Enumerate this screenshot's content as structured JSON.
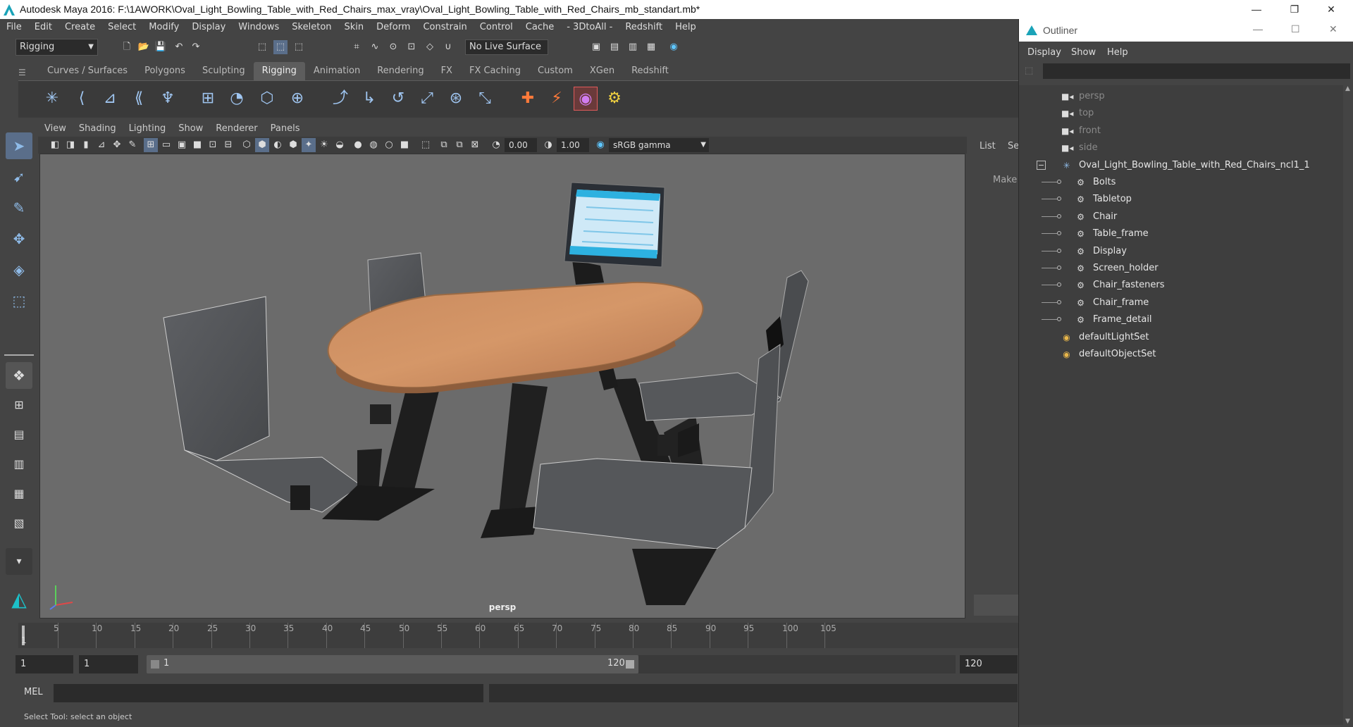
{
  "window": {
    "title": "Autodesk Maya 2016: F:\\1AWORK\\Oval_Light_Bowling_Table_with_Red_Chairs_max_vray\\Oval_Light_Bowling_Table_with_Red_Chairs_mb_standart.mb*",
    "controls": [
      "—",
      "❐",
      "✕"
    ]
  },
  "menubar": [
    "File",
    "Edit",
    "Create",
    "Select",
    "Modify",
    "Display",
    "Windows",
    "Skeleton",
    "Skin",
    "Deform",
    "Constrain",
    "Control",
    "Cache",
    "- 3DtoAll -",
    "Redshift",
    "Help"
  ],
  "statusline": {
    "mode": "Rigging",
    "live_surface": "No Live Surface"
  },
  "shelf_tabs": {
    "items": [
      "Curves / Surfaces",
      "Polygons",
      "Sculpting",
      "Rigging",
      "Animation",
      "Rendering",
      "FX",
      "FX Caching",
      "Custom",
      "XGen",
      "Redshift"
    ],
    "active": "Rigging"
  },
  "panel": {
    "menu": [
      "View",
      "Shading",
      "Lighting",
      "Show",
      "Renderer",
      "Panels"
    ],
    "exposure": "0.00",
    "gamma": "1.00",
    "color_space": "sRGB gamma",
    "camera": "persp"
  },
  "right_strip": {
    "list_label": "List",
    "se_label": "Se",
    "make_label": "Make"
  },
  "timeline": {
    "ticks": [
      "5",
      "10",
      "15",
      "20",
      "25",
      "30",
      "35",
      "40",
      "45",
      "50",
      "55",
      "60",
      "65",
      "70",
      "75",
      "80",
      "85",
      "90",
      "95",
      "100",
      "105"
    ],
    "current_frame": "1"
  },
  "range": {
    "start": "1",
    "playback_start": "1",
    "slider_start": "1",
    "slider_end": "120",
    "end": "120"
  },
  "mel": {
    "label": "MEL"
  },
  "help_line": "Select Tool: select an object",
  "outliner": {
    "title": "Outliner",
    "menu": [
      "Display",
      "Show",
      "Help"
    ],
    "items": [
      {
        "label": "persp",
        "type": "camera",
        "dim": true,
        "indent": 0
      },
      {
        "label": "top",
        "type": "camera",
        "dim": true,
        "indent": 0
      },
      {
        "label": "front",
        "type": "camera",
        "dim": true,
        "indent": 0
      },
      {
        "label": "side",
        "type": "camera",
        "dim": true,
        "indent": 0
      },
      {
        "label": "Oval_Light_Bowling_Table_with_Red_Chairs_ncl1_1",
        "type": "group",
        "dim": false,
        "indent": 0
      },
      {
        "label": "Bolts",
        "type": "mesh",
        "dim": false,
        "indent": 1
      },
      {
        "label": "Tabletop",
        "type": "mesh",
        "dim": false,
        "indent": 1
      },
      {
        "label": "Chair",
        "type": "mesh",
        "dim": false,
        "indent": 1
      },
      {
        "label": "Table_frame",
        "type": "mesh",
        "dim": false,
        "indent": 1
      },
      {
        "label": "Display",
        "type": "mesh",
        "dim": false,
        "indent": 1
      },
      {
        "label": "Screen_holder",
        "type": "mesh",
        "dim": false,
        "indent": 1
      },
      {
        "label": "Chair_fasteners",
        "type": "mesh",
        "dim": false,
        "indent": 1
      },
      {
        "label": "Chair_frame",
        "type": "mesh",
        "dim": false,
        "indent": 1
      },
      {
        "label": "Frame_detail",
        "type": "mesh",
        "dim": false,
        "indent": 1
      },
      {
        "label": "defaultLightSet",
        "type": "set",
        "dim": false,
        "indent": 0
      },
      {
        "label": "defaultObjectSet",
        "type": "set",
        "dim": false,
        "indent": 0
      }
    ]
  },
  "colors": {
    "ui_bg": "#444444",
    "viewport_bg": "#6b6b6b",
    "tabletop": "#c98a5e",
    "chair": "#545659",
    "frame": "#1e1e1e",
    "accent": "#5d8fcf"
  }
}
